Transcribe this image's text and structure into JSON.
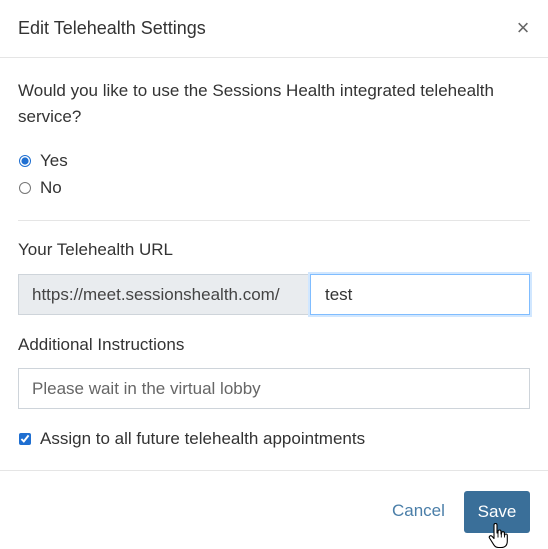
{
  "modal": {
    "title": "Edit Telehealth Settings",
    "close_glyph": "×",
    "close_icon": "close-icon"
  },
  "telehealth": {
    "question": "Would you like to use the Sessions Health integrated telehealth service?",
    "options": [
      {
        "label": "Yes",
        "selected": true
      },
      {
        "label": "No",
        "selected": false
      }
    ]
  },
  "url": {
    "label": "Your Telehealth URL",
    "prefix": "https://meet.sessionshealth.com/",
    "value": "test"
  },
  "instructions": {
    "label": "Additional Instructions",
    "placeholder": "Please wait in the virtual lobby"
  },
  "assign": {
    "label": "Assign to all future telehealth appointments",
    "checked": true
  },
  "footer": {
    "cancel_label": "Cancel",
    "save_label": "Save"
  },
  "colors": {
    "accent": "#1f6fd1",
    "save_button": "#3a6f99",
    "cancel_link": "#4a7ea8"
  }
}
